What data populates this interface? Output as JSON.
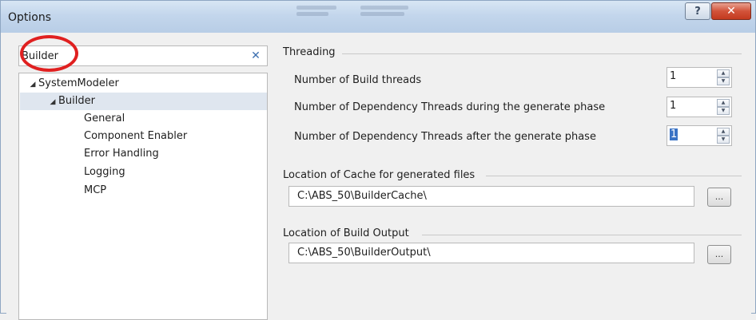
{
  "window": {
    "title": "Options",
    "help_icon": "question-mark-icon",
    "close_icon": "close-x-icon"
  },
  "search": {
    "value": "Builder",
    "clear_icon": "clear-x-icon"
  },
  "tree": {
    "root": {
      "label": "SystemModeler",
      "expanded": true
    },
    "builder": {
      "label": "Builder",
      "expanded": true,
      "selected": true
    },
    "children": [
      {
        "label": "General"
      },
      {
        "label": "Component Enabler"
      },
      {
        "label": "Error Handling"
      },
      {
        "label": "Logging"
      },
      {
        "label": "MCP"
      }
    ]
  },
  "threading": {
    "group_label": "Threading",
    "rows": [
      {
        "label": "Number of Build threads",
        "value": "1"
      },
      {
        "label": "Number of Dependency Threads during the generate phase",
        "value": "1"
      },
      {
        "label": "Number of Dependency Threads after the generate phase",
        "value": "1"
      }
    ]
  },
  "cache": {
    "group_label": "Location of Cache for generated files",
    "path": "C:\\ABS_50\\BuilderCache\\",
    "browse_label": "..."
  },
  "output": {
    "group_label": "Location of Build Output",
    "path": "C:\\ABS_50\\BuilderOutput\\",
    "browse_label": "..."
  },
  "colors": {
    "selection": "#3b73c4",
    "annotation_circle": "#e02020",
    "close_button": "#d2533a"
  }
}
